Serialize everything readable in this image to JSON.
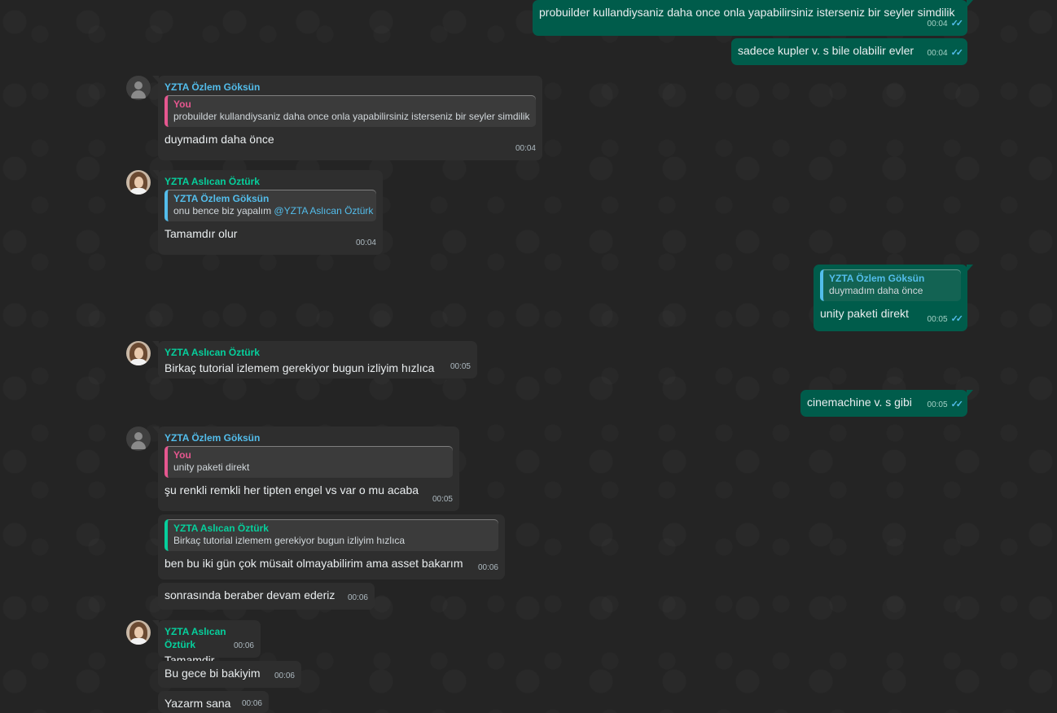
{
  "messages": [
    {
      "id": "m1",
      "text": "probuilder kullandiysaniz daha once onla yapabilirsiniz isterseniz bir seyler simdilik",
      "time": "00:04"
    },
    {
      "id": "m2",
      "text": "sadece kupler v. s bile olabilir evler",
      "time": "00:04"
    },
    {
      "id": "m3",
      "sender": "YZTA Özlem Göksün",
      "quote_name": "You",
      "quote_text": "probuilder kullandiysaniz daha once onla yapabilirsiniz isterseniz bir seyler simdilik",
      "text": "duymadım daha önce",
      "time": "00:04"
    },
    {
      "id": "m4",
      "sender": "YZTA Aslıcan Öztürk",
      "quote_name": "YZTA Özlem Göksün",
      "quote_text": "onu bence biz yapalım ",
      "quote_mention": "@YZTA Aslıcan Öztürk",
      "text": "Tamamdır olur",
      "time": "00:04"
    },
    {
      "id": "m5",
      "quote_name": "YZTA Özlem Göksün",
      "quote_text": "duymadım daha önce",
      "text": "unity paketi direkt",
      "time": "00:05"
    },
    {
      "id": "m6",
      "sender": "YZTA Aslıcan Öztürk",
      "text": "Birkaç tutorial izlemem gerekiyor bugun izliyim hızlıca",
      "time": "00:05"
    },
    {
      "id": "m7",
      "text": "cinemachine v. s gibi",
      "time": "00:05"
    },
    {
      "id": "m8",
      "sender": "YZTA Özlem Göksün",
      "quote_name": "You",
      "quote_text": "unity paketi direkt",
      "text": "şu renkli remkli her tipten engel vs var o mu acaba",
      "time": "00:05"
    },
    {
      "id": "m9",
      "quote_name": "YZTA Aslıcan Öztürk",
      "quote_text": "Birkaç tutorial izlemem gerekiyor bugun izliyim hızlıca",
      "text": "ben bu iki gün çok müsait olmayabilirim ama asset bakarım",
      "time": "00:06"
    },
    {
      "id": "m10",
      "text": "sonrasında beraber devam ederiz",
      "time": "00:06"
    },
    {
      "id": "m11",
      "sender": "YZTA Aslıcan Öztürk",
      "text": "Tamamdir",
      "time": "00:06"
    },
    {
      "id": "m12",
      "text": "Bu gece bi bakiyim",
      "time": "00:06"
    },
    {
      "id": "m13",
      "text": "Yazarm sana",
      "time": "00:06"
    }
  ],
  "icons": {
    "read_receipt": "double-check-icon",
    "default_avatar": "person-icon",
    "photo_avatar": "profile-photo"
  },
  "colors": {
    "background": "#242424",
    "incoming_bubble": "#2e2e2e",
    "outgoing_bubble": "#005c4b",
    "blue_name": "#53bdeb",
    "teal_name": "#06cf9c",
    "you_quote": "#e5578f",
    "read_tick": "#53bdeb"
  }
}
